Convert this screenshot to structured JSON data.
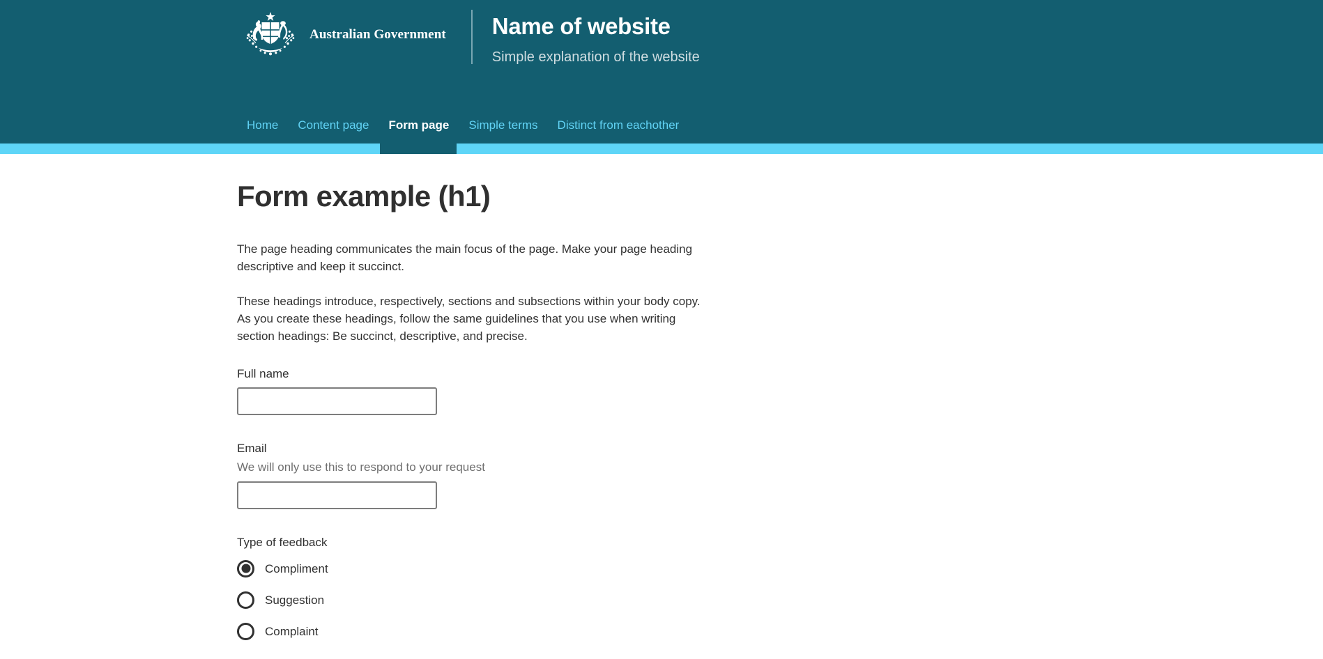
{
  "header": {
    "crest_alt": "Commonwealth Coat of Arms",
    "government_text": "Australian Government",
    "site_name": "Name of website",
    "tagline": "Simple explanation of the website"
  },
  "nav": {
    "items": [
      {
        "label": "Home",
        "active": false
      },
      {
        "label": "Content page",
        "active": false
      },
      {
        "label": "Form page",
        "active": true
      },
      {
        "label": "Simple terms",
        "active": false
      },
      {
        "label": "Distinct from eachother",
        "active": false
      }
    ]
  },
  "main": {
    "page_title": "Form example (h1)",
    "paragraph_one": "The page heading communicates the main focus of the page. Make your page heading descriptive and keep it succinct.",
    "paragraph_two": "These headings introduce, respectively, sections and subsections within your body copy. As you create these headings, follow the same guidelines that you use when writing section headings: Be succinct, descriptive, and precise."
  },
  "form": {
    "full_name": {
      "label": "Full name",
      "value": "",
      "placeholder": ""
    },
    "email": {
      "label": "Email",
      "hint": "We will only use this to respond to your request",
      "value": "",
      "placeholder": ""
    },
    "feedback_type": {
      "legend": "Type of feedback",
      "options": [
        {
          "label": "Compliment",
          "selected": true
        },
        {
          "label": "Suggestion",
          "selected": false
        },
        {
          "label": "Complaint",
          "selected": false
        }
      ]
    }
  },
  "colors": {
    "header_teal": "#135e70",
    "accent_blue": "#5ed5f7",
    "nav_link": "#61d3f5",
    "text_dark": "#313131",
    "hint_gray": "#6f6f6f",
    "input_border": "#7d7d7d"
  }
}
